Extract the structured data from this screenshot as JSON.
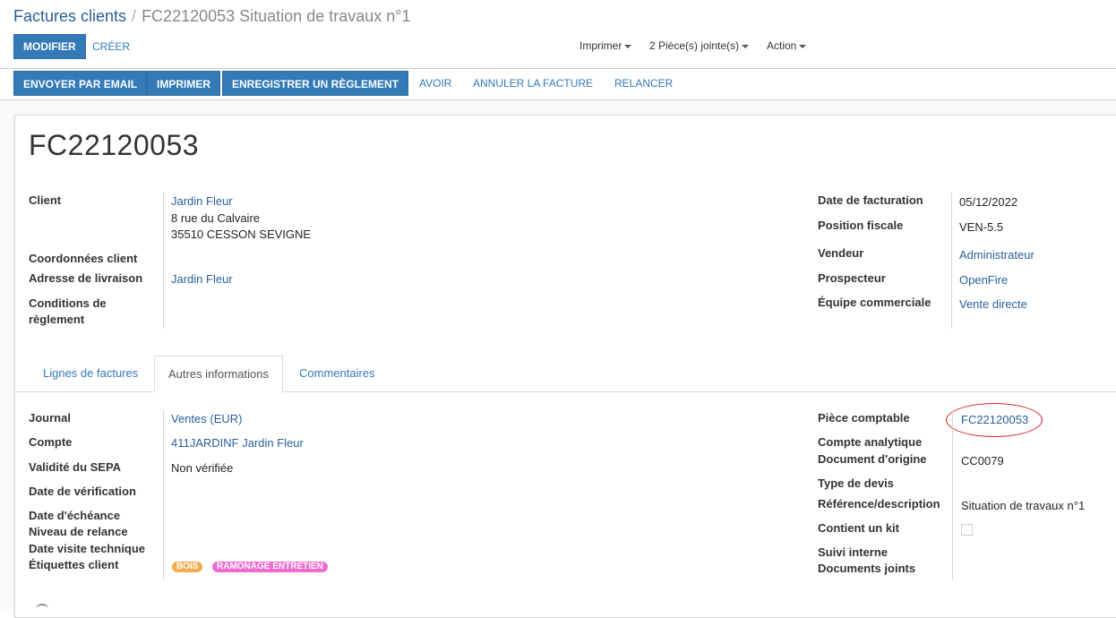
{
  "breadcrumb": {
    "parent": "Factures clients",
    "separator": "/",
    "current": "FC22120053 Situation de travaux n°1"
  },
  "control_panel": {
    "modify_label": "MODIFIER",
    "create_label": "CRÉER",
    "print_label": "Imprimer",
    "attachments_label": "2 Pièce(s) jointe(s)",
    "action_label": "Action"
  },
  "statusbar": {
    "send_email": "ENVOYER PAR EMAIL",
    "print": "IMPRIMER",
    "register_payment": "ENREGISTRER UN RÈGLEMENT",
    "credit_note": "AVOIR",
    "cancel_invoice": "ANNULER LA FACTURE",
    "reminder": "RELANCER"
  },
  "invoice": {
    "number": "FC22120053",
    "left_fields": {
      "client_label": "Client",
      "client_name": "Jardin Fleur",
      "client_street": "8 rue du Calvaire",
      "client_city": "35510 CESSON SEVIGNE",
      "contact_label": "Coordonnées client",
      "delivery_label": "Adresse de livraison",
      "delivery_value": "Jardin Fleur",
      "payment_terms_label": "Conditions de règlement"
    },
    "right_fields": {
      "invoice_date_label": "Date de facturation",
      "invoice_date_value": "05/12/2022",
      "fiscal_position_label": "Position fiscale",
      "fiscal_position_value": "VEN-5.5",
      "salesperson_label": "Vendeur",
      "salesperson_value": "Administrateur",
      "prospector_label": "Prospecteur",
      "prospector_value": "OpenFire",
      "sales_team_label": "Équipe commerciale",
      "sales_team_value": "Vente directe"
    }
  },
  "tabs": [
    {
      "label": "Lignes de factures",
      "active": false
    },
    {
      "label": "Autres informations",
      "active": true
    },
    {
      "label": "Commentaires",
      "active": false
    }
  ],
  "other_info": {
    "left": {
      "journal_label": "Journal",
      "journal_value": "Ventes (EUR)",
      "account_label": "Compte",
      "account_value": "411JARDINF Jardin Fleur",
      "sepa_label": "Validité du SEPA",
      "sepa_value": "Non vérifiée",
      "verification_date_label": "Date de vérification",
      "due_date_label": "Date d'échéance",
      "reminder_level_label": "Niveau de relance",
      "inspection_date_label": "Date visite technique",
      "client_tags_label": "Étiquettes client",
      "tags": [
        {
          "label": "BOIS",
          "color": "#f0ad4e"
        },
        {
          "label": "RAMONAGE ENTRETIEN",
          "color": "#f06bd0"
        }
      ]
    },
    "right": {
      "accounting_entry_label": "Pièce comptable",
      "accounting_entry_value": "FC22120053",
      "analytic_account_label": "Compte analytique",
      "origin_document_label": "Document d'origine",
      "origin_document_value": "CC0079",
      "quote_type_label": "Type de devis",
      "reference_label": "Référence/description",
      "reference_value": "Situation de travaux n°1",
      "contains_kit_label": "Contient un kit",
      "contains_kit_value": false,
      "internal_followup_label": "Suivi interne",
      "attached_docs_label": "Documents joints"
    }
  },
  "colors": {
    "primary": "#337ab7",
    "link": "#2a5f97",
    "highlight_oval": "#d61f1f"
  }
}
